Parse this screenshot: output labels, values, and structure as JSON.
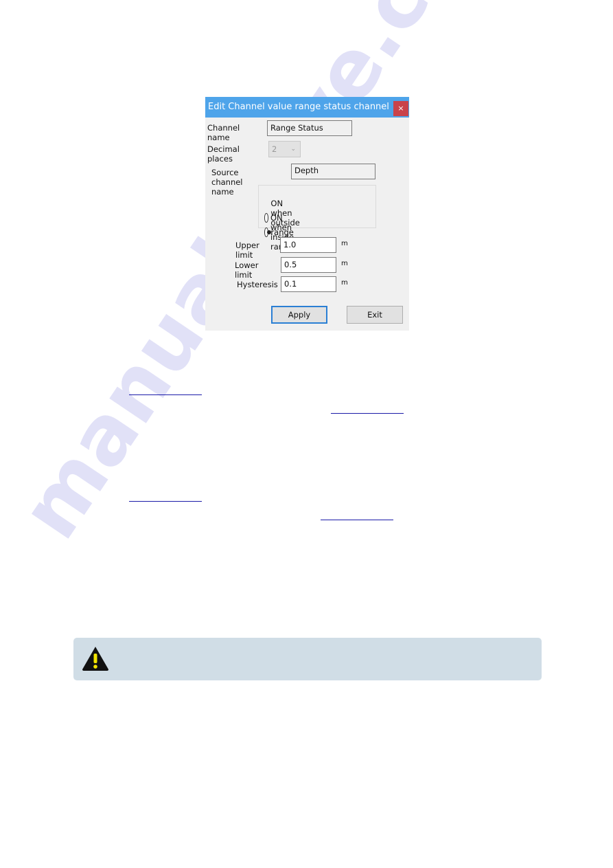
{
  "watermark": "manualshive.com",
  "dialog": {
    "title": "Edit Channel value range status channel",
    "close_label": "×",
    "channel_name_label": "Channel name",
    "channel_name_value": "Range Status",
    "decimal_places_label": "Decimal places",
    "decimal_places_value": "2",
    "source_channel_label": "Source channel name",
    "source_channel_value": "Depth",
    "radio_outside": "ON when outside range",
    "radio_inside": "ON when inside range",
    "selected_radio": "ON when inside range",
    "upper_label": "Upper limit",
    "upper_value": "1.0",
    "lower_label": "Lower limit",
    "lower_value": "0.5",
    "hyst_label": "Hysteresis",
    "hyst_value": "0.1",
    "unit": "m",
    "apply_label": "Apply",
    "exit_label": "Exit"
  },
  "note": {
    "icon": "warning-icon"
  }
}
